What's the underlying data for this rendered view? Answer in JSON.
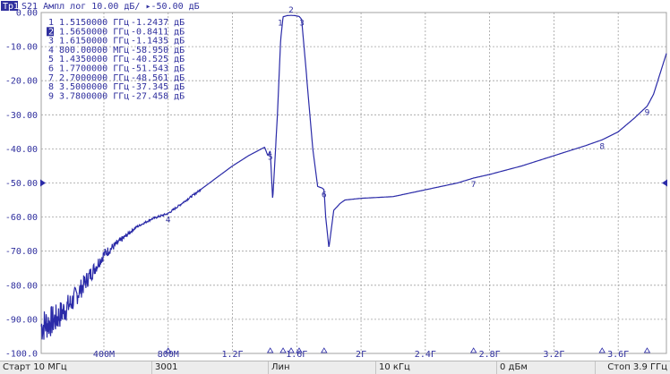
{
  "header": {
    "trace_tag": "Тр1",
    "trace_info": "S21 Ампл лог 10.00 дБ/ ▸-50.00 дБ"
  },
  "y_axis": {
    "ticks": [
      "0.00",
      "-10.00",
      "-20.00",
      "-30.00",
      "-40.00",
      "-50.00",
      "-60.00",
      "-70.00",
      "-80.00",
      "-90.00",
      "-100.0"
    ],
    "reference_level": -50
  },
  "x_axis": {
    "ticks": [
      {
        "label": "400М",
        "f": 0.4
      },
      {
        "label": "800М",
        "f": 0.8
      },
      {
        "label": "1.2Г",
        "f": 1.2
      },
      {
        "label": "1.6Г",
        "f": 1.6
      },
      {
        "label": "2Г",
        "f": 2.0
      },
      {
        "label": "2.4Г",
        "f": 2.4
      },
      {
        "label": "2.8Г",
        "f": 2.8
      },
      {
        "label": "3.2Г",
        "f": 3.2
      },
      {
        "label": "3.6Г",
        "f": 3.6
      }
    ]
  },
  "markers": [
    {
      "id": "1",
      "freq": "1.5150000 ГГц",
      "value": "-1.2437 дБ"
    },
    {
      "id": "2",
      "freq": "1.5650000 ГГц",
      "value": "-0.8411 дБ"
    },
    {
      "id": "3",
      "freq": "1.6150000 ГГц",
      "value": "-1.1435 дБ"
    },
    {
      "id": "4",
      "freq": "800.00000 МГц",
      "value": "-58.950 дБ"
    },
    {
      "id": "5",
      "freq": "1.4350000 ГГц",
      "value": "-40.525 дБ"
    },
    {
      "id": "6",
      "freq": "1.7700000 ГГц",
      "value": "-51.543 дБ"
    },
    {
      "id": "7",
      "freq": "2.7000000 ГГц",
      "value": "-48.561 дБ"
    },
    {
      "id": "8",
      "freq": "3.5000000 ГГц",
      "value": "-37.345 дБ"
    },
    {
      "id": "9",
      "freq": "3.7800000 ГГц",
      "value": "-27.458 дБ"
    }
  ],
  "active_marker": "2",
  "status": {
    "start": "Старт 10 МГц",
    "points": "3001",
    "sweep": "Лин",
    "ifbw": "10 кГц",
    "power": "0 дБм",
    "stop": "Стоп 3.9 ГГц"
  },
  "colors": {
    "trace": "#2b2ba8",
    "grid": "#a0a0a0",
    "text": "#2f2f9e",
    "header_tag_bg": "#2f2f9e",
    "header_tag_fg": "#ffffff"
  },
  "chart_data": {
    "type": "line",
    "title": "",
    "xlabel": "",
    "ylabel": "",
    "xlim": [
      0.01,
      3.9
    ],
    "ylim": [
      -100,
      0
    ],
    "x_unit": "GHz",
    "y_unit": "dB",
    "series": [
      {
        "x": [
          0.01,
          0.1,
          0.2,
          0.3,
          0.4,
          0.5,
          0.6,
          0.7,
          0.8,
          0.9,
          1.0,
          1.1,
          1.2,
          1.3,
          1.4,
          1.42,
          1.435,
          1.45,
          1.48,
          1.5,
          1.515,
          1.54,
          1.565,
          1.59,
          1.615,
          1.63,
          1.66,
          1.7,
          1.73,
          1.76,
          1.77,
          1.78,
          1.8,
          1.83,
          1.87,
          1.9,
          2.0,
          2.2,
          2.4,
          2.6,
          2.7,
          2.8,
          3.0,
          3.2,
          3.4,
          3.5,
          3.6,
          3.7,
          3.78,
          3.82,
          3.86,
          3.9
        ],
        "y": [
          -92,
          -90,
          -85,
          -78,
          -71,
          -67,
          -63,
          -60.5,
          -58.95,
          -55.5,
          -52,
          -48.5,
          -45,
          -42,
          -39.5,
          -42,
          -40.525,
          -55,
          -30,
          -8,
          -1.2437,
          -0.9,
          -0.8411,
          -0.9,
          -1.1435,
          -2,
          -18,
          -40,
          -51,
          -51.543,
          -52,
          -60,
          -69,
          -58,
          -56,
          -55,
          -54.5,
          -54,
          -52,
          -50,
          -48.561,
          -47.5,
          -45,
          -42,
          -39,
          -37.345,
          -35,
          -31,
          -27.458,
          -24,
          -18,
          -12
        ]
      }
    ]
  }
}
